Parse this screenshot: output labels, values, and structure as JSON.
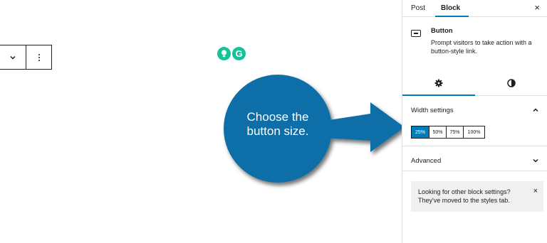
{
  "toolbar": {
    "more_icon": "chevron-down-icon",
    "options_icon": "more-vertical-icon"
  },
  "extensions": {
    "g_label": "G"
  },
  "callout": {
    "line1": "Choose the",
    "line2": "button size."
  },
  "sidebar": {
    "tabs": {
      "post": "Post",
      "block": "Block",
      "close": "×"
    },
    "block_card": {
      "title": "Button",
      "description": "Prompt visitors to take action with a button-style link."
    },
    "width_settings": {
      "title": "Width settings",
      "options": [
        "25%",
        "50%",
        "75%",
        "100%"
      ],
      "selected": "25%"
    },
    "advanced": {
      "title": "Advanced"
    },
    "notice": {
      "text": "Looking for other block settings? They've moved to the styles tab.",
      "close": "×"
    }
  },
  "colors": {
    "accent": "#007cba",
    "callout": "#0d6ea8",
    "extension": "#15c39a"
  }
}
